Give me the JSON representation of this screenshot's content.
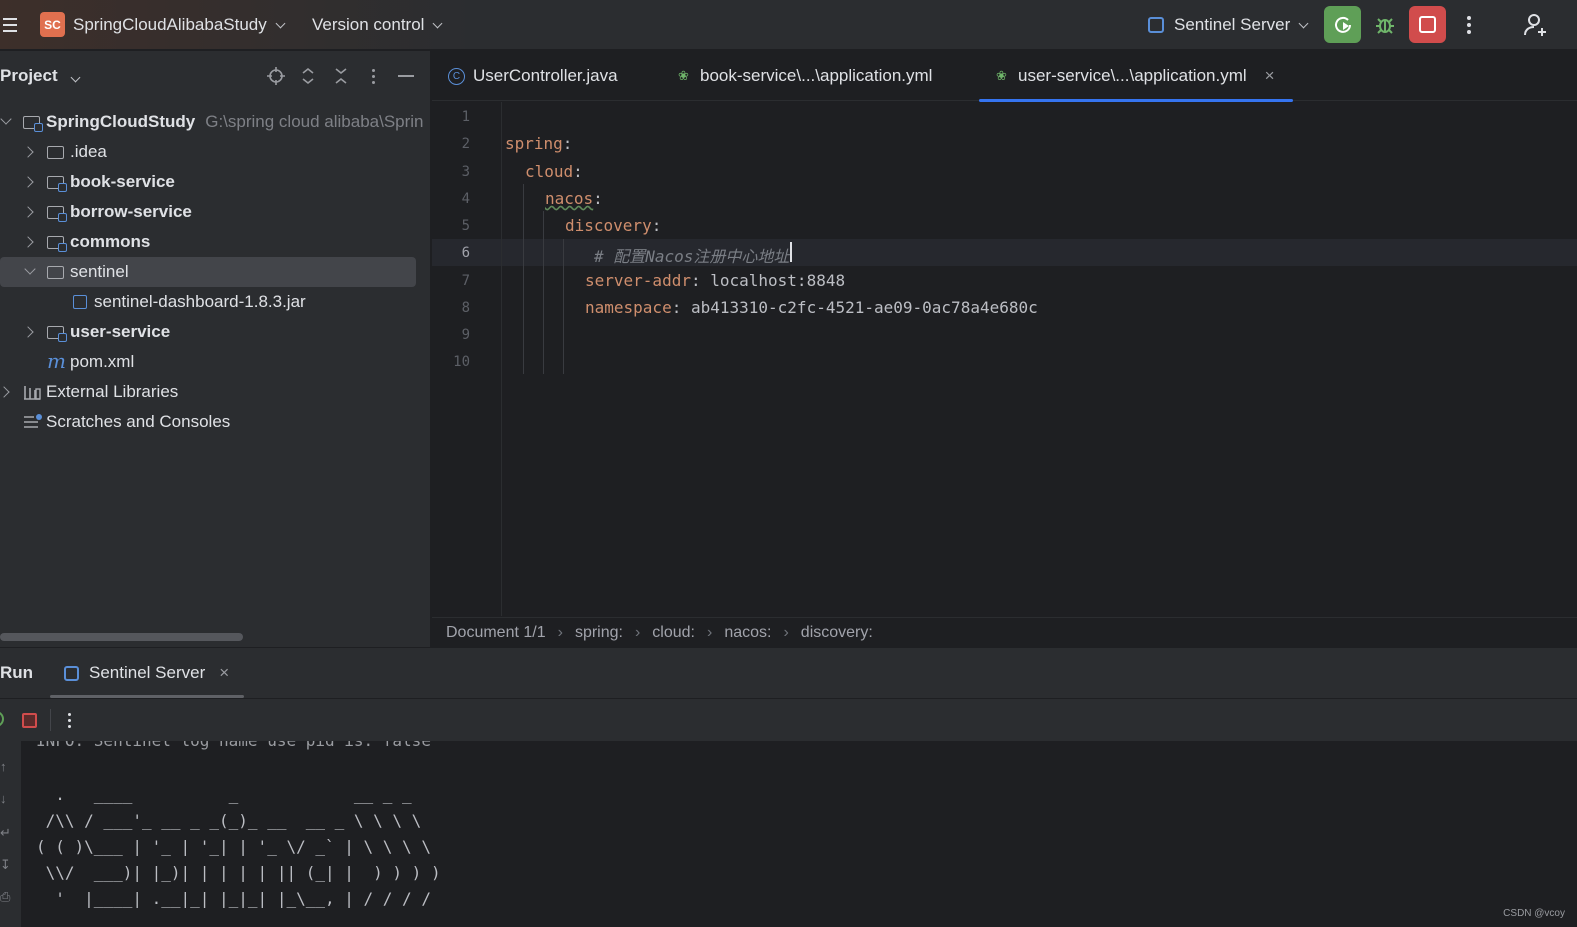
{
  "topbar": {
    "project_badge": "SC",
    "project_name": "SpringCloudAlibabaStudy",
    "vcs_label": "Version control",
    "run_config": "Sentinel Server"
  },
  "project_panel": {
    "title": "Project",
    "tree": [
      {
        "label": "SpringCloudStudy",
        "hint": "G:\\spring cloud alibaba\\Sprin"
      },
      {
        "label": ".idea"
      },
      {
        "label": "book-service"
      },
      {
        "label": "borrow-service"
      },
      {
        "label": "commons"
      },
      {
        "label": "sentinel"
      },
      {
        "label": "sentinel-dashboard-1.8.3.jar"
      },
      {
        "label": "user-service"
      },
      {
        "label": "pom.xml"
      },
      {
        "label": "External Libraries"
      },
      {
        "label": "Scratches and Consoles"
      }
    ]
  },
  "editor": {
    "tabs": [
      {
        "label": "UserController.java"
      },
      {
        "label": "book-service\\...\\application.yml"
      },
      {
        "label": "user-service\\...\\application.yml"
      }
    ],
    "line_numbers": [
      "1",
      "2",
      "3",
      "4",
      "5",
      "6",
      "7",
      "8",
      "9",
      "10"
    ],
    "code": {
      "l2_key": "spring",
      "l2_colon": ":",
      "l3_key": "cloud",
      "l3_colon": ":",
      "l4_key": "nacos",
      "l4_colon": ":",
      "l5_key": "discovery",
      "l5_colon": ":",
      "l6_comment": "# 配置Nacos注册中心地址",
      "l7_key": "server-addr",
      "l7_value": ": localhost:8848",
      "l8_key": "namespace",
      "l8_value": ": ab413310-c2fc-4521-ae09-0ac78a4e680c"
    },
    "breadcrumbs": [
      "Document 1/1",
      "spring:",
      "cloud:",
      "nacos:",
      "discovery:"
    ]
  },
  "run_panel": {
    "title": "Run",
    "tab_label": "Sentinel Server",
    "console": [
      "INFO: Sentinel log name use pid is: false",
      "",
      "  .   ____          _            __ _ _",
      " /\\\\ / ___'_ __ _ _(_)_ __  __ _ \\ \\ \\ \\",
      "( ( )\\___ | '_ | '_| | '_ \\/ _` | \\ \\ \\ \\",
      " \\\\/  ___)| |_)| | | | | || (_| |  ) ) ) )",
      "  '  |____| .__|_| |_|_| |_\\__, | / / / /"
    ]
  },
  "watermark": "CSDN @vcoy"
}
